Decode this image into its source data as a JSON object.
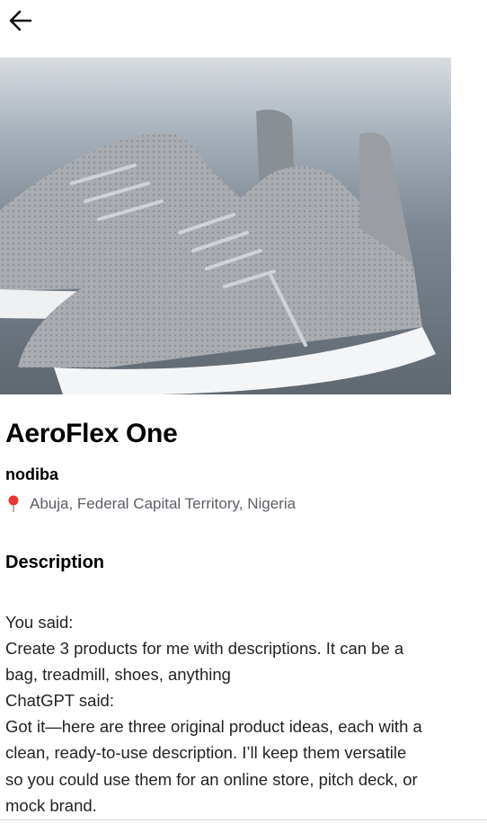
{
  "header": {
    "back_icon": "arrow-left-icon"
  },
  "product": {
    "image_alt": "grey knit running sneakers with white soles",
    "title": "AeroFlex One",
    "seller": "nodiba",
    "location_icon": "map-pin-icon",
    "location": "Abuja, Federal Capital Territory, Nigeria"
  },
  "description": {
    "heading": "Description",
    "lines": [
      "You said:",
      "Create 3 products for me with descriptions. It can be a",
      "bag, treadmill, shoes, anything",
      "ChatGPT said:",
      "Got it—here are three original product ideas, each with a",
      "clean, ready-to-use description. I’ll keep them versatile",
      "so you could use them for an online store, pitch deck, or",
      "mock brand."
    ]
  },
  "colors": {
    "pin": "#e53935",
    "secondary_text": "#5b5f66",
    "body_text": "#232323"
  }
}
